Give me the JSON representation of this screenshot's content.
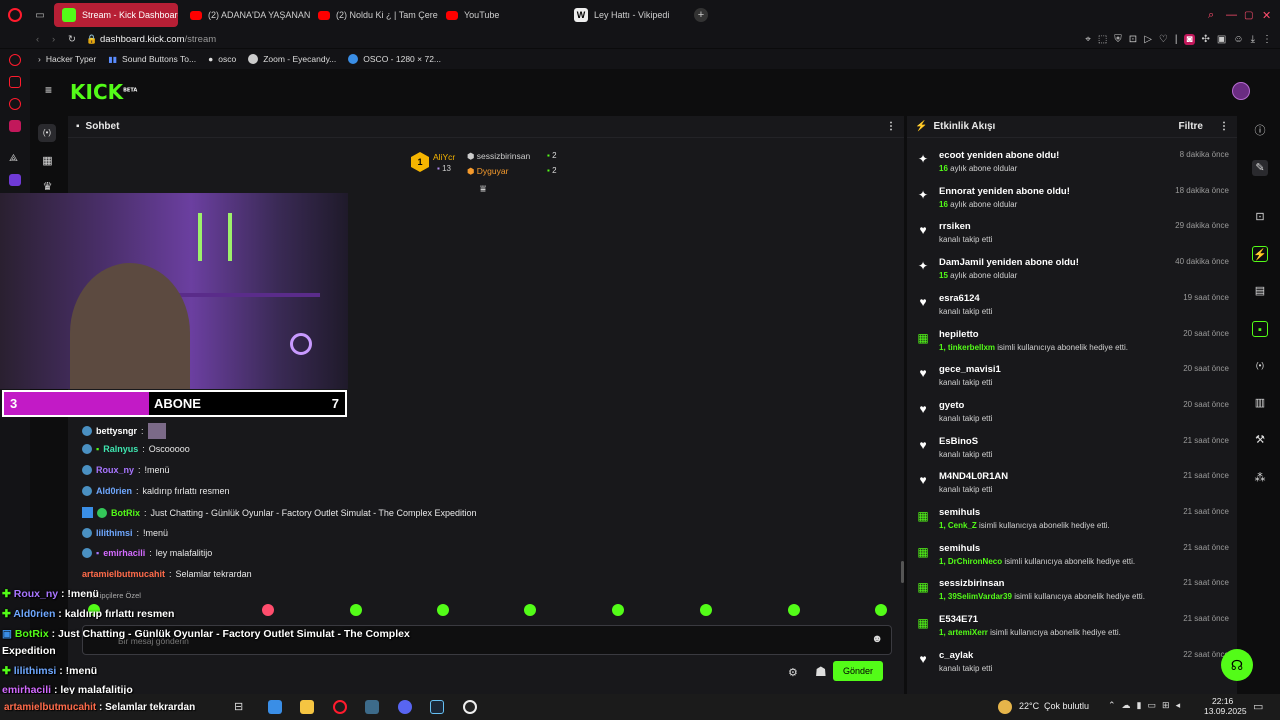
{
  "browser": {
    "tabs": [
      {
        "label": "Stream - Kick Dashboard",
        "active": true
      },
      {
        "label": "(2) ADANA'DA YAŞANAN"
      },
      {
        "label": "(2) Noldu Ki ¿ | Tam Çere"
      },
      {
        "label": "YouTube"
      },
      {
        "label": "Ley Hattı - Vikipedi"
      }
    ],
    "url_domain": "dashboard.kick.com",
    "url_path": "/stream",
    "bookmarks": [
      "Hacker Typer",
      "Sound Buttons To...",
      "osco",
      "Zoom - Eyecandy...",
      "OSCO - 1280 × 72..."
    ]
  },
  "kick": {
    "logo": "KICK",
    "logo_sup": "BETA",
    "chat": {
      "title": "Sohbet",
      "top": [
        {
          "name": "AliYcr",
          "count": "13"
        },
        {
          "name": "sessizbirinsan",
          "count": "2"
        },
        {
          "name": "Dyguyar",
          "count": "2"
        }
      ],
      "messages": [
        {
          "user": "bettysngr",
          "text": ""
        },
        {
          "user": "Ralnyus",
          "text": "Oscooooo"
        },
        {
          "user": "Roux_ny",
          "text": "!menü"
        },
        {
          "user": "Ald0rien",
          "text": "kaldırıp fırlattı resmen"
        },
        {
          "user": "BotRix",
          "text": "Just Chatting - Günlük Oyunlar - Factory Outlet Simulat - The Complex Expedition"
        },
        {
          "user": "lilithimsi",
          "text": "!menü"
        },
        {
          "user": "emirhacili",
          "text": "ley malafalitijo"
        },
        {
          "user": "artamielbutmucahit",
          "text": "Selamlar tekrardan"
        }
      ],
      "input_placeholder": "Bir mesaj gönderin",
      "send_label": "Gönder",
      "followers_only": "Takipçilere Özel"
    },
    "activity": {
      "title": "Etkinlik Akışı",
      "filter_label": "Filtre",
      "events": [
        {
          "icon": "star",
          "title": "ecoot yeniden abone oldu!",
          "sub_hl": "16",
          "sub": "aylık abone oldular",
          "time": "8 dakika önce"
        },
        {
          "icon": "star",
          "title": "Ennorat yeniden abone oldu!",
          "sub_hl": "16",
          "sub": "aylık abone oldular",
          "time": "18 dakika önce"
        },
        {
          "icon": "heart",
          "title": "rrsiken",
          "sub_hl": "",
          "sub": "kanalı takip etti",
          "time": "29 dakika önce"
        },
        {
          "icon": "star",
          "title": "DamJamil yeniden abone oldu!",
          "sub_hl": "15",
          "sub": "aylık abone oldular",
          "time": "40 dakika önce"
        },
        {
          "icon": "heart",
          "title": "esra6124",
          "sub_hl": "",
          "sub": "kanalı takip etti",
          "time": "19 saat önce"
        },
        {
          "icon": "gift",
          "title": "hepiletto",
          "sub_hl": "1, tinkerbellxm",
          "sub": "isimli kullanıcıya abonelik hediye etti.",
          "time": "20 saat önce"
        },
        {
          "icon": "heart",
          "title": "gece_mavisi1",
          "sub_hl": "",
          "sub": "kanalı takip etti",
          "time": "20 saat önce"
        },
        {
          "icon": "heart",
          "title": "gyeto",
          "sub_hl": "",
          "sub": "kanalı takip etti",
          "time": "20 saat önce"
        },
        {
          "icon": "heart",
          "title": "EsBinoS",
          "sub_hl": "",
          "sub": "kanalı takip etti",
          "time": "21 saat önce"
        },
        {
          "icon": "heart",
          "title": "M4ND4L0R1AN",
          "sub_hl": "",
          "sub": "kanalı takip etti",
          "time": "21 saat önce"
        },
        {
          "icon": "gift",
          "title": "semihuls",
          "sub_hl": "1, Cenk_Z",
          "sub": "isimli kullanıcıya abonelik hediye etti.",
          "time": "21 saat önce"
        },
        {
          "icon": "gift",
          "title": "semihuls",
          "sub_hl": "1, DrChironNeco",
          "sub": "isimli kullanıcıya abonelik hediye etti.",
          "time": "21 saat önce"
        },
        {
          "icon": "gift",
          "title": "sessizbirinsan",
          "sub_hl": "1, 39SelimVardar39",
          "sub": "isimli kullanıcıya abonelik hediye etti.",
          "time": "21 saat önce"
        },
        {
          "icon": "gift",
          "title": "E534E71",
          "sub_hl": "1, artemiXerr",
          "sub": "isimli kullanıcıya abonelik hediye etti.",
          "time": "21 saat önce"
        },
        {
          "icon": "heart",
          "title": "c_aylak",
          "sub_hl": "",
          "sub": "kanalı takip etti",
          "time": "22 saat önce"
        }
      ]
    }
  },
  "overlay": {
    "sub_goal_current": "3",
    "sub_goal_label": "ABONE",
    "sub_goal_target": "7",
    "chat_lines": [
      {
        "user": "Roux_ny",
        "text": "!menü"
      },
      {
        "user": "Ald0rien",
        "text": "kaldırıp fırlattı resmen"
      },
      {
        "user": "BotRix",
        "text": "Just Chatting - Günlük Oyunlar - Factory Outlet Simulat - The Complex"
      },
      {
        "user": "",
        "text": "Expedition"
      },
      {
        "user": "lilithimsi",
        "text": "!menü"
      },
      {
        "user": "emirhacili",
        "text": "ley malafalitijo"
      },
      {
        "user": "artamielbutmucahit",
        "text": "Selamlar tekrardan"
      }
    ]
  },
  "taskbar": {
    "weather": "22°C",
    "weather_desc": "Çok bulutlu",
    "time": "22:16",
    "date": "13.09.2025"
  },
  "colors": {
    "kick_green": "#53fc18",
    "tab_red": "#b71f35",
    "opera_red": "#ff1b2d"
  }
}
